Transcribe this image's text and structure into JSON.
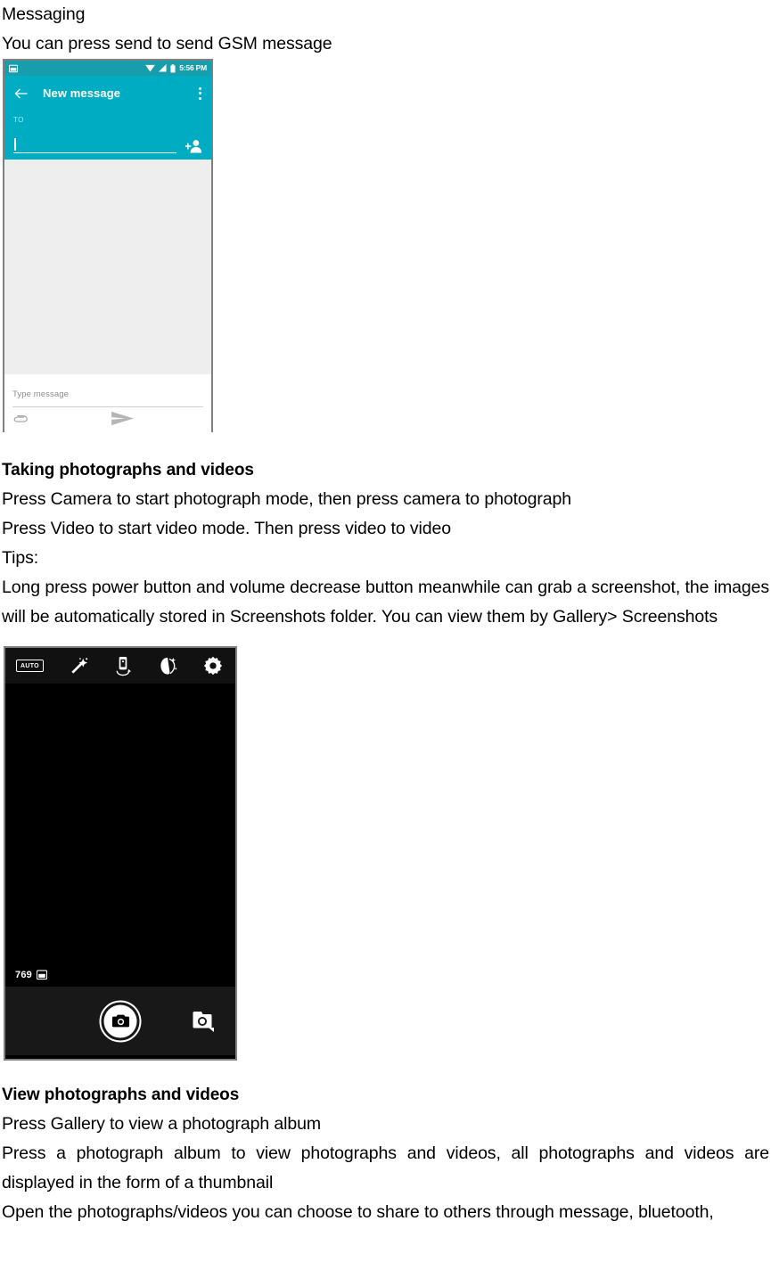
{
  "document": {
    "section_messaging": {
      "heading": "Messaging",
      "line": "You can press send to send GSM message"
    },
    "section_taking": {
      "heading": "Taking photographs and videos",
      "line1": "Press Camera to start photograph mode, then press camera to photograph",
      "line2": "Press Video to start video mode. Then press video to video",
      "line3": "Tips:",
      "paragraph": "Long press power button and volume decrease button meanwhile can grab a screenshot, the images will be automatically stored in Screenshots folder. You can view them by Gallery> Screenshots"
    },
    "section_view": {
      "heading": "View photographs and videos",
      "line1": "Press Gallery to view a photograph album",
      "paragraph": "Press a photograph album to view photographs and videos, all photographs and videos are displayed in the form of a thumbnail",
      "line_last": "Open the photographs/videos you can choose to share to others through message, bluetooth,"
    }
  },
  "messaging_screenshot": {
    "statusbar": {
      "notification_icon": "screenshot-notification-icon",
      "wifi_icon": "wifi-icon",
      "signal_icon": "signal-icon",
      "battery_icon": "battery-icon",
      "clock": "5:56 PM"
    },
    "appbar": {
      "back_icon": "back-arrow-icon",
      "title": "New message",
      "overflow_icon": "overflow-menu-icon",
      "color": "#00acc1"
    },
    "recipient": {
      "label": "TO",
      "value": "",
      "add_contact_icon": "add-contact-icon"
    },
    "compose": {
      "placeholder": "Type message",
      "value": "",
      "attach_icon": "attachment-icon",
      "send_icon": "send-icon"
    }
  },
  "camera_screenshot": {
    "toolbar": [
      {
        "name": "flash-auto-icon",
        "label": "AUTO"
      },
      {
        "name": "magic-wand-icon",
        "label": ""
      },
      {
        "name": "panorama-icon",
        "label": ""
      },
      {
        "name": "beauty-face-icon",
        "label": ""
      },
      {
        "name": "settings-gear-icon",
        "label": ""
      }
    ],
    "counter": {
      "remaining": "769",
      "storage_icon": "sd-storage-icon"
    },
    "shutter_icon": "shutter-camera-icon",
    "mode_switch_icon": "camera-mode-icon"
  }
}
